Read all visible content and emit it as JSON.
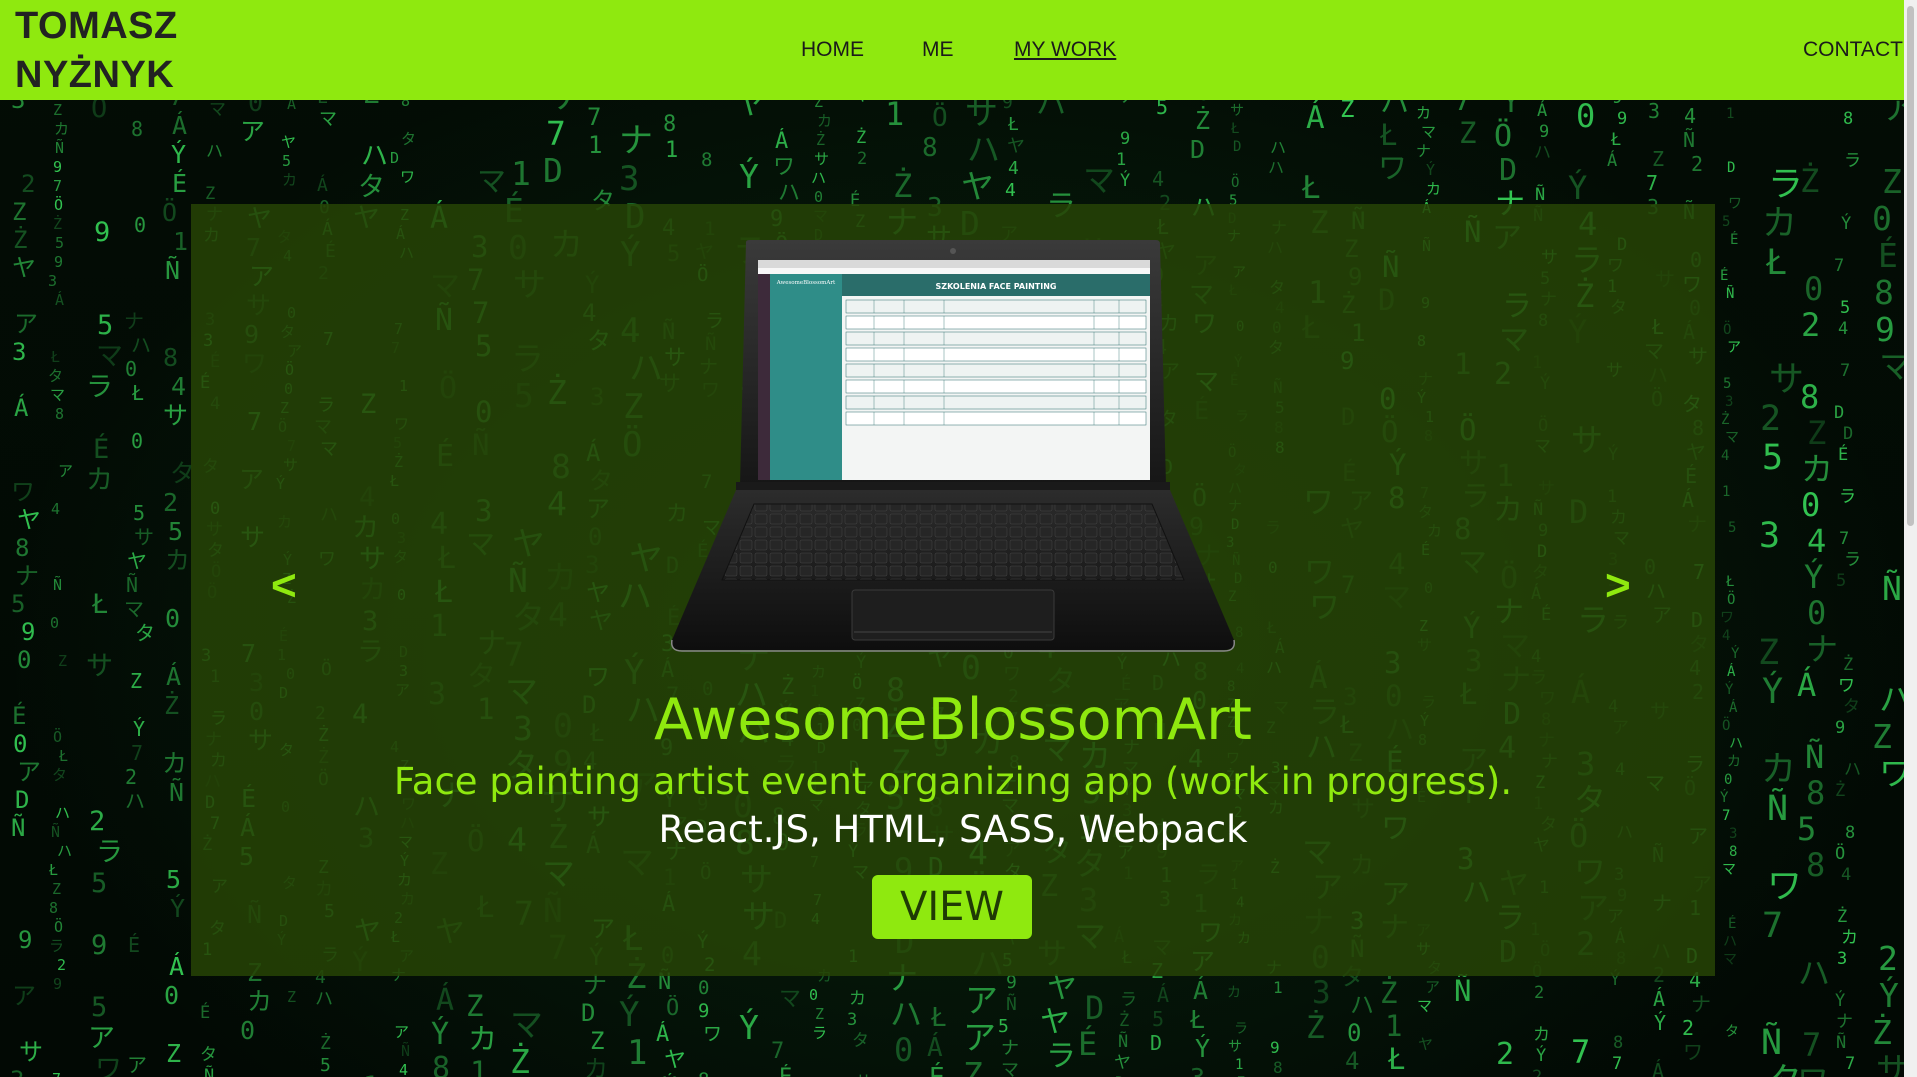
{
  "header": {
    "logo_line1": "TOMASZ",
    "logo_line2": "NYŻNYK",
    "nav": {
      "home": "HOME",
      "me": "ME",
      "my_work": "MY WORK",
      "contact": "CONTACT"
    }
  },
  "slider": {
    "prev": "<",
    "next": ">",
    "project_title": "AwesomeBlossomArt",
    "project_description": "Face painting artist event organizing app (work in progress).",
    "project_tech": "React.JS, HTML, SASS, Webpack",
    "view_label": "VIEW",
    "screen": {
      "app_name": "AwesomeBlossomArt",
      "heading": "SZKOLENIA FACE PAINTING"
    }
  },
  "colors": {
    "accent": "#8fe90f",
    "panel": "#264406",
    "matrix_green": "#2fbf4f"
  }
}
